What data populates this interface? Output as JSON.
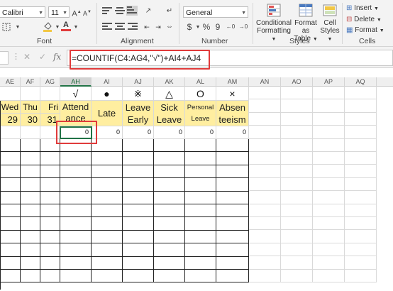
{
  "ribbon": {
    "font_name": "Calibri",
    "font_size": "11",
    "number_format": "General",
    "groups": {
      "font": "Font",
      "alignment": "Alignment",
      "number": "Number",
      "styles": "Styles",
      "cells": "Cells"
    },
    "number_symbols": {
      "currency": "$",
      "percent": "%",
      "comma": "9"
    },
    "styles_buttons": [
      {
        "label": "Conditional",
        "label2": "Formatting"
      },
      {
        "label": "Format as",
        "label2": "Table"
      },
      {
        "label": "Cell",
        "label2": "Styles"
      }
    ],
    "cells_buttons": {
      "insert": "Insert",
      "delete": "Delete",
      "format": "Format"
    },
    "accent_fill": "#f2c744",
    "accent_font": "#e03b3b"
  },
  "formula_bar": {
    "formula": "=COUNTIF(C4:AG4,\"√\")+AI4+AJ4"
  },
  "columns": [
    "AE",
    "AF",
    "AG",
    "AH",
    "AI",
    "AJ",
    "AK",
    "AL",
    "AM",
    "AN",
    "AO",
    "AP",
    "AQ"
  ],
  "selected_column": "AH",
  "symbols": {
    "ah": "√",
    "ai": "●",
    "aj": "※",
    "ak": "△",
    "al": "O",
    "am": "×"
  },
  "days": {
    "ae": "Wed",
    "af": "Thu",
    "ag": "Fri"
  },
  "dates": {
    "ae": "29",
    "af": "30",
    "ag": "31"
  },
  "headers": {
    "ah": [
      "Attend",
      "ance"
    ],
    "ai": "Late",
    "aj": [
      "Leave",
      "Early"
    ],
    "ak": [
      "Sick",
      "Leave"
    ],
    "al": [
      "Personal",
      "Leave"
    ],
    "am": [
      "Absen",
      "teeism"
    ]
  },
  "values": {
    "ah": "0",
    "ai": "0",
    "aj": "0",
    "ak": "0",
    "al": "0",
    "am": "0"
  },
  "colors": {
    "highlight": "#ffeea0",
    "annotation": "#e03b3b",
    "selection": "#217346"
  }
}
